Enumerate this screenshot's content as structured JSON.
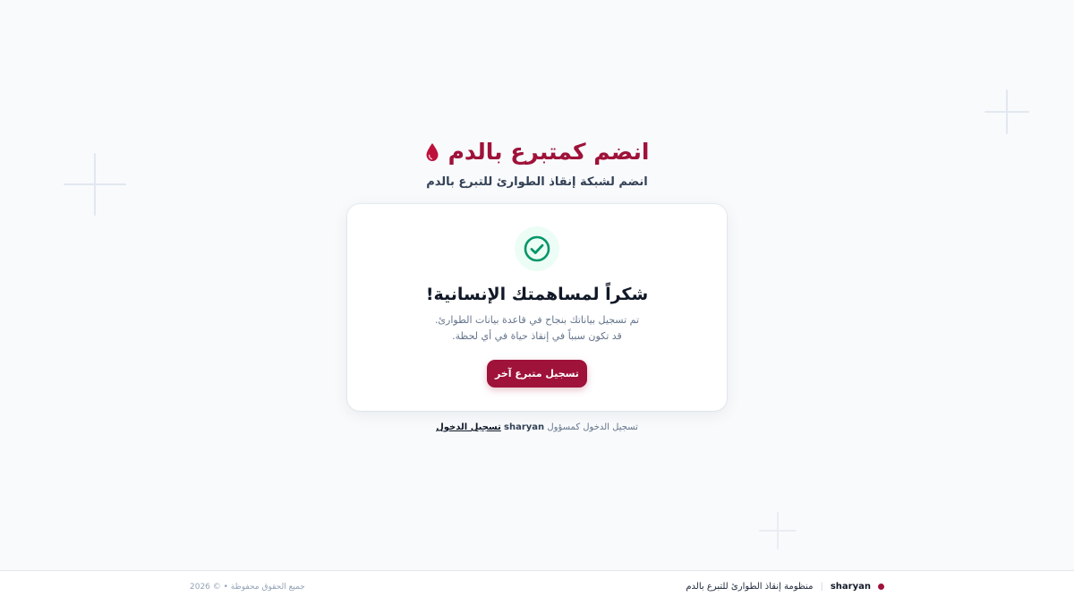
{
  "header": {
    "title": "انضم كمتبرع بالدم",
    "subtitle": "انضم لشبكة إنقاذ الطوارئ للتبرع بالدم"
  },
  "card": {
    "icon": "check-circle-icon",
    "title": "شكراً لمساهمتك الإنسانية!",
    "line1": "تم تسجيل بياناتك بنجاح في قاعدة بيانات الطوارئ.",
    "line2": "قد تكون سبباً في إنقاذ حياة في أي لحظة.",
    "button_label": "تسجيل متبرع آخر"
  },
  "login": {
    "prefix": "تسجيل الدخول كمسؤول",
    "brand": "sharyan",
    "link_label": "تسجيل الدخول"
  },
  "footer": {
    "brand": "sharyan",
    "separator": "|",
    "description": "منظومة إنقاذ الطوارئ للتبرع بالدم",
    "copyright": "جميع الحقوق محفوظة • © 2026"
  },
  "colors": {
    "brand": "#9f1239",
    "success": "#059669",
    "background": "#f8fafc"
  }
}
